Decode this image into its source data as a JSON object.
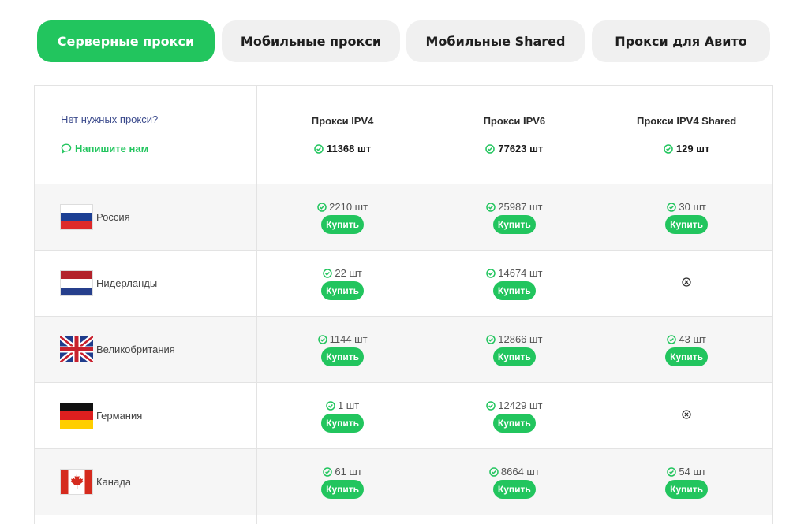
{
  "tabs": [
    {
      "label": "Серверные прокси",
      "active": true
    },
    {
      "label": "Мобильные прокси",
      "active": false
    },
    {
      "label": "Мобильные Shared",
      "active": false
    },
    {
      "label": "Прокси для Авито",
      "active": false
    }
  ],
  "header": {
    "help_text": "Нет нужных прокси?",
    "contact_label": "Напишите нам",
    "columns": [
      {
        "title": "Прокси IPV4",
        "total": "11368 шт"
      },
      {
        "title": "Прокси IPV6",
        "total": "77623 шт"
      },
      {
        "title": "Прокси IPV4 Shared",
        "total": "129 шт"
      }
    ]
  },
  "buy_label": "Купить",
  "rows": [
    {
      "country": "Россия",
      "flag": "flag-russia-icon",
      "cells": [
        "2210 шт",
        "25987 шт",
        "30 шт"
      ]
    },
    {
      "country": "Нидерланды",
      "flag": "flag-netherlands-icon",
      "cells": [
        "22 шт",
        "14674 шт",
        null
      ]
    },
    {
      "country": "Великобритания",
      "flag": "flag-uk-icon",
      "cells": [
        "1144 шт",
        "12866 шт",
        "43 шт"
      ]
    },
    {
      "country": "Германия",
      "flag": "flag-germany-icon",
      "cells": [
        "1 шт",
        "12429 шт",
        null
      ]
    },
    {
      "country": "Канада",
      "flag": "flag-canada-icon",
      "cells": [
        "61 шт",
        "8664 шт",
        "54 шт"
      ]
    }
  ],
  "colors": {
    "accent": "#22c55e",
    "tab_bg": "#f0f0f0",
    "link": "#3b4a8c"
  }
}
